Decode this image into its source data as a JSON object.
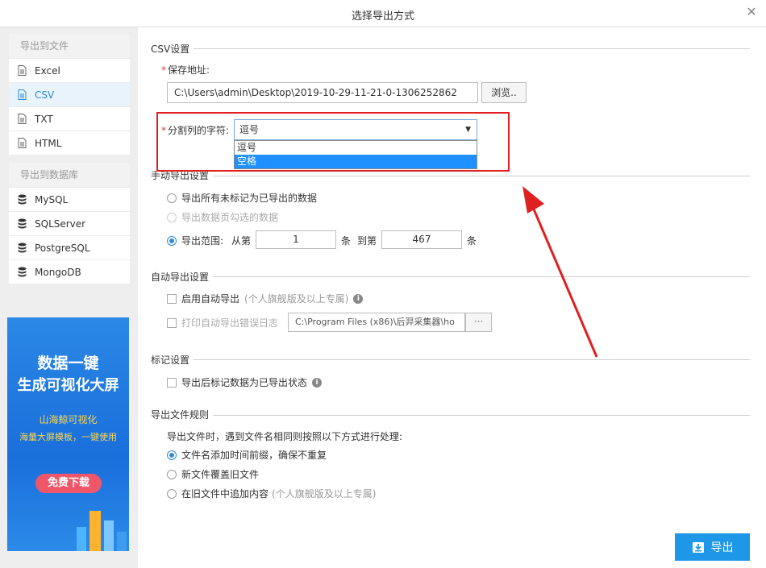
{
  "window": {
    "title": "选择导出方式",
    "close_glyph": "✕"
  },
  "sidebar": {
    "file_group": {
      "title": "导出到文件",
      "items": [
        {
          "label": "Excel",
          "icon": "file-icon"
        },
        {
          "label": "CSV",
          "icon": "file-icon",
          "active": true
        },
        {
          "label": "TXT",
          "icon": "file-icon"
        },
        {
          "label": "HTML",
          "icon": "file-icon"
        }
      ]
    },
    "db_group": {
      "title": "导出到数据库",
      "items": [
        {
          "label": "MySQL",
          "icon": "database-icon"
        },
        {
          "label": "SQLServer",
          "icon": "database-icon"
        },
        {
          "label": "PostgreSQL",
          "icon": "database-icon"
        },
        {
          "label": "MongoDB",
          "icon": "database-icon"
        }
      ]
    },
    "ad": {
      "line1": "数据一键",
      "line2": "生成可视化大屏",
      "line3": "山海鲸可视化",
      "line4": "海量大屏模板，一键使用",
      "button": "免费下载"
    }
  },
  "csv": {
    "section_title": "CSV设置",
    "save_path_label": "保存地址:",
    "save_path_value": "C:\\Users\\admin\\Desktop\\2019-10-29-11-21-0-1306252862",
    "browse_label": "浏览..",
    "separator_label": "分割列的字符:",
    "separator_value": "逗号",
    "separator_options": [
      "逗号",
      "空格"
    ],
    "separator_highlighted": "空格"
  },
  "manual": {
    "section_title": "手动导出设置",
    "opt_unexported": "导出所有未标记为已导出的数据",
    "opt_selected": "导出数据页勾选的数据",
    "opt_range": "导出范围:",
    "from_label": "从第",
    "from_value": "1",
    "unit1": "条",
    "to_label": "到第",
    "to_value": "467",
    "unit2": "条"
  },
  "auto": {
    "section_title": "自动导出设置",
    "enable_label": "启用自动导出",
    "enable_note": "(个人旗舰版及以上专属)",
    "log_label": "打印自动导出错误日志",
    "log_path": "C:\\Program Files (x86)\\后羿采集器\\ho",
    "log_browse": "···"
  },
  "mark": {
    "section_title": "标记设置",
    "mark_label": "导出后标记数据为已导出状态"
  },
  "rules": {
    "section_title": "导出文件规则",
    "intro": "导出文件时，遇到文件名相同则按照以下方式进行处理:",
    "opt1": "文件名添加时间前缀，确保不重复",
    "opt2": "新文件覆盖旧文件",
    "opt3": "在旧文件中追加内容",
    "opt3_note": "(个人旗舰版及以上专属)"
  },
  "footer": {
    "export_label": "导出"
  },
  "colors": {
    "accent": "#1e97e8",
    "annotation": "#e02020",
    "active_bg": "#e8f3fb"
  }
}
